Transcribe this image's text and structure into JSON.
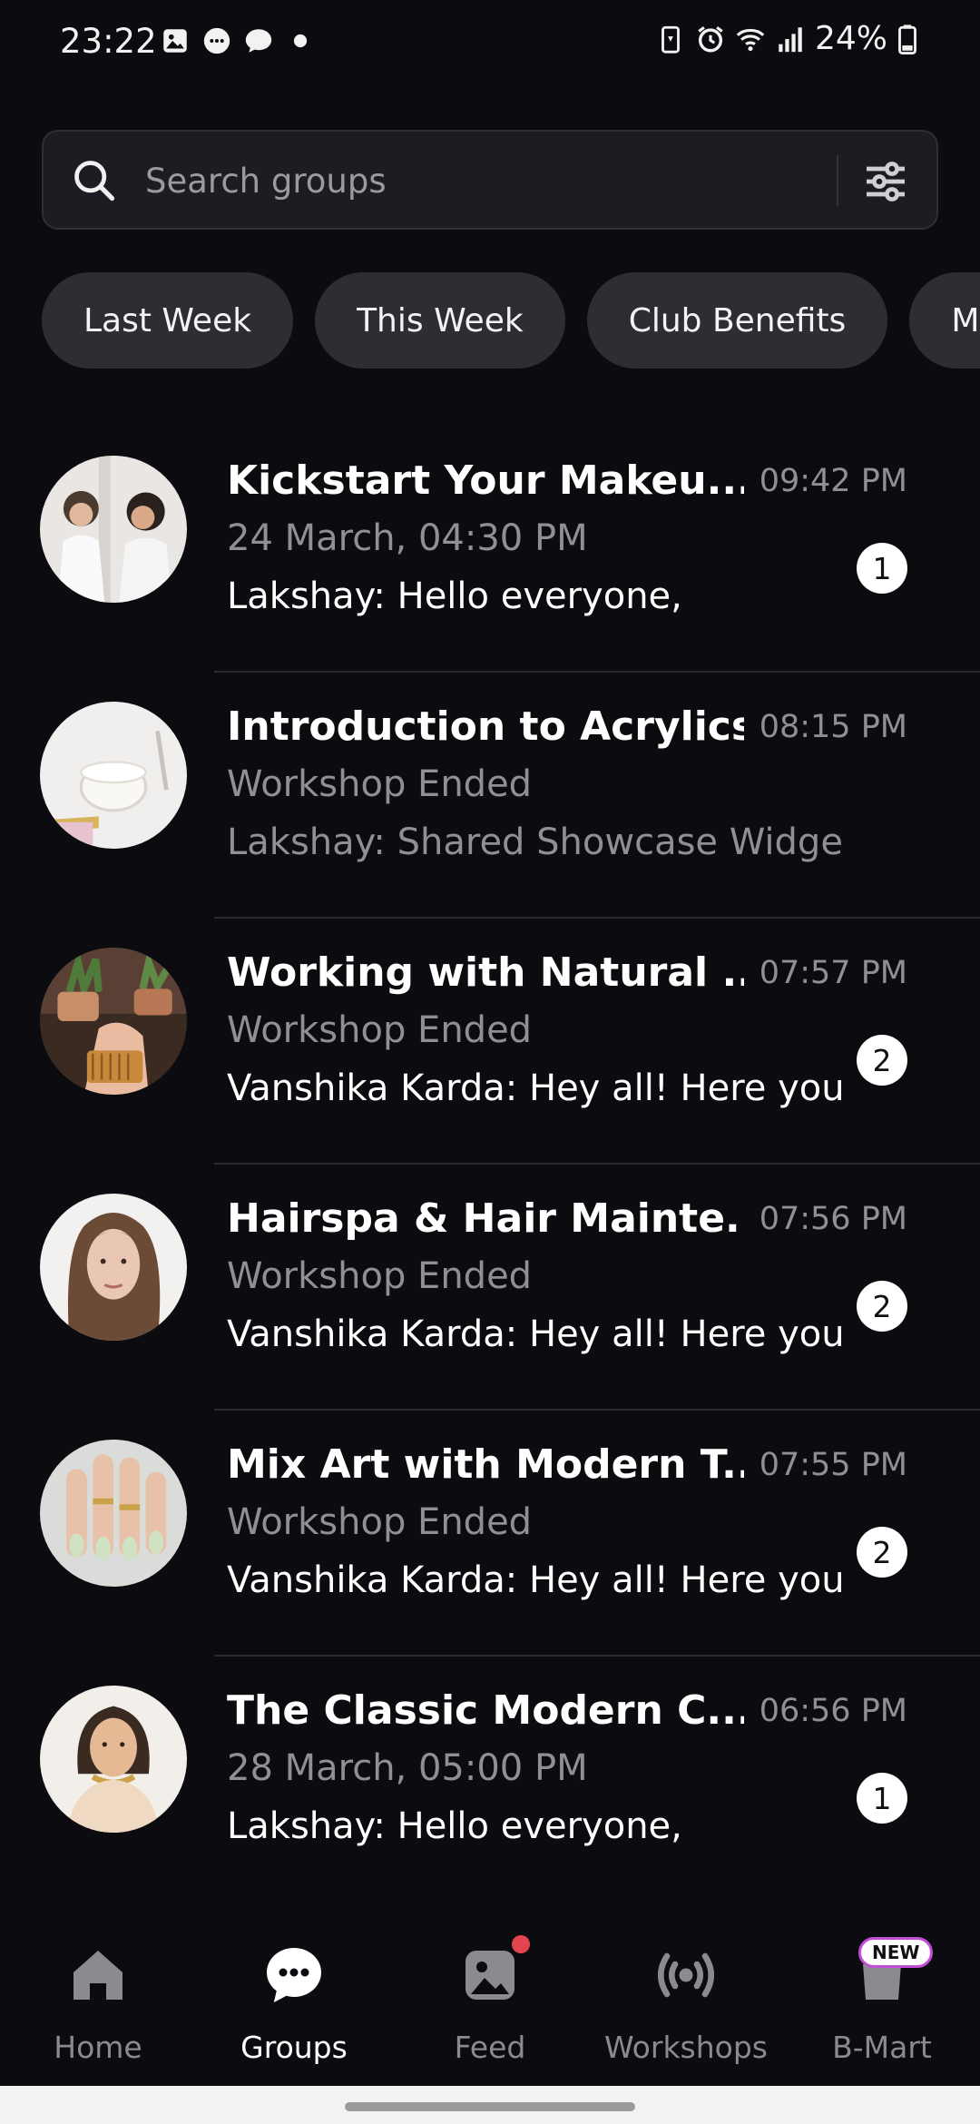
{
  "status_bar": {
    "time": "23:22",
    "battery": "24%",
    "icons": [
      "gallery-icon",
      "chat-bubble-icon",
      "message-icon",
      "dot-icon",
      "battery-saver-icon",
      "alarm-icon",
      "wifi-icon",
      "signal-icon",
      "battery-icon"
    ]
  },
  "search": {
    "placeholder": "Search groups",
    "value": ""
  },
  "filters": {
    "chips": [
      "Last Week",
      "This Week",
      "Club Benefits",
      "Makeup"
    ]
  },
  "groups": [
    {
      "title": "Kickstart Your Makeu...",
      "time": "09:42 PM",
      "subtitle": "24 March, 04:30 PM",
      "message": "Lakshay: Hello everyone,",
      "unread": "1"
    },
    {
      "title": "Introduction to Acrylics",
      "time": "08:15 PM",
      "subtitle": "Workshop Ended",
      "message": "Lakshay: Shared Showcase Widget",
      "unread": ""
    },
    {
      "title": "Working with Natural ...",
      "time": "07:57 PM",
      "subtitle": "Workshop Ended",
      "message": "Vanshika Karda: Hey all! Here you",
      "unread": "2"
    },
    {
      "title": "Hairspa & Hair Mainte...",
      "time": "07:56 PM",
      "subtitle": "Workshop Ended",
      "message": "Vanshika Karda: Hey all! Here you",
      "unread": "2"
    },
    {
      "title": "Mix Art with Modern T...",
      "time": "07:55 PM",
      "subtitle": "Workshop Ended",
      "message": "Vanshika Karda: Hey all! Here you",
      "unread": "2"
    },
    {
      "title": "The Classic Modern C...",
      "time": "06:56 PM",
      "subtitle": "28 March, 05:00 PM",
      "message": "Lakshay: Hello everyone,",
      "unread": "1"
    }
  ],
  "nav": {
    "items": [
      {
        "label": "Home",
        "icon": "home-icon"
      },
      {
        "label": "Groups",
        "icon": "chat-icon"
      },
      {
        "label": "Feed",
        "icon": "feed-icon"
      },
      {
        "label": "Workshops",
        "icon": "broadcast-icon"
      },
      {
        "label": "B-Mart",
        "icon": "bag-icon"
      }
    ],
    "active": "Groups",
    "new_badge": "NEW"
  },
  "colors": {
    "background": "#0c0c10",
    "chip": "#2d2d33",
    "muted_text": "#8f8f96",
    "notification_dot": "#e4444d",
    "new_badge_border": "#c44dd8"
  }
}
